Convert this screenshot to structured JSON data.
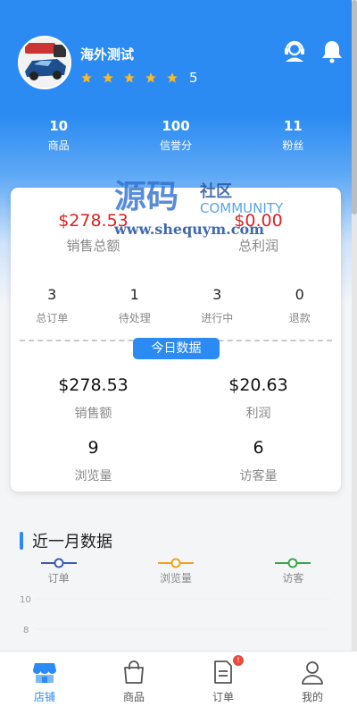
{
  "header": {
    "shop_name": "海外测试",
    "rating": 5,
    "rating_text": "5"
  },
  "stats": [
    {
      "value": "10",
      "label": "商品"
    },
    {
      "value": "100",
      "label": "信誉分"
    },
    {
      "value": "11",
      "label": "粉丝"
    }
  ],
  "summary": [
    {
      "value": "$278.53",
      "label": "销售总额"
    },
    {
      "value": "$0.00",
      "label": "总利润"
    }
  ],
  "orders": [
    {
      "value": "3",
      "label": "总订单"
    },
    {
      "value": "1",
      "label": "待处理"
    },
    {
      "value": "3",
      "label": "进行中"
    },
    {
      "value": "0",
      "label": "退款"
    }
  ],
  "today": {
    "title": "今日数据",
    "items": [
      {
        "value": "$278.53",
        "label": "销售额"
      },
      {
        "value": "$20.63",
        "label": "利润"
      },
      {
        "value": "9",
        "label": "浏览量"
      },
      {
        "value": "6",
        "label": "访客量"
      }
    ]
  },
  "month": {
    "title": "近一月数据",
    "legend": [
      {
        "name": "订单",
        "color": "#3b5bb5"
      },
      {
        "name": "浏览量",
        "color": "#f0a020"
      },
      {
        "name": "访客",
        "color": "#3aa64a"
      }
    ],
    "chart_data": {
      "type": "line",
      "y_ticks": [
        "10",
        "8"
      ],
      "series": [
        {
          "name": "订单"
        },
        {
          "name": "浏览量"
        },
        {
          "name": "访客"
        }
      ]
    }
  },
  "watermark": {
    "big": "源码",
    "small": "社区",
    "community": "COMMUNITY",
    "url": "www.shequym.com"
  },
  "tabs": [
    {
      "label": "店铺",
      "active": true
    },
    {
      "label": "商品",
      "active": false
    },
    {
      "label": "订单",
      "active": false,
      "badge": "!"
    },
    {
      "label": "我的",
      "active": false
    }
  ],
  "colors": {
    "primary": "#2b8bf2",
    "red": "#e02020",
    "star": "#f5b82e"
  }
}
